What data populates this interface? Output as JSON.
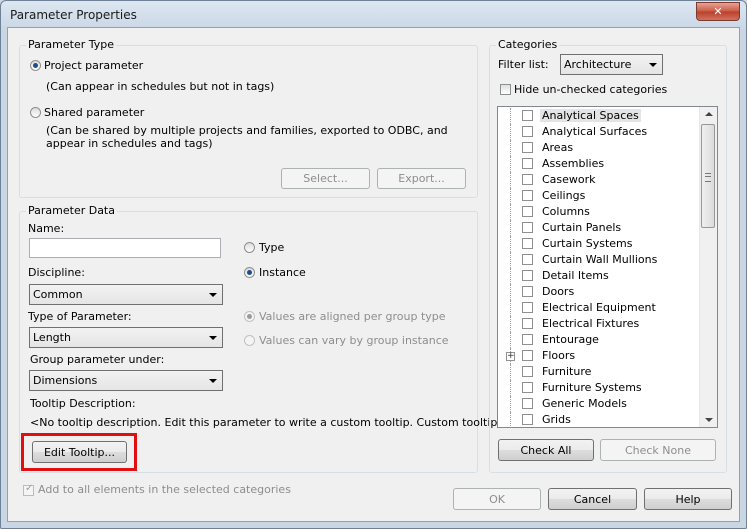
{
  "window": {
    "title": "Parameter Properties",
    "close_glyph": "✕"
  },
  "parameter_type": {
    "label": "Parameter Type",
    "project": {
      "label": "Project parameter",
      "desc": "(Can appear in schedules but not in tags)",
      "selected": true
    },
    "shared": {
      "label": "Shared parameter",
      "desc_line1": "(Can be shared by multiple projects and families, exported to ODBC, and",
      "desc_line2": "appear in schedules and tags)"
    },
    "select_button": "Select...",
    "export_button": "Export..."
  },
  "parameter_data": {
    "label": "Parameter Data",
    "name_label": "Name:",
    "name_value": "",
    "discipline_label": "Discipline:",
    "discipline_value": "Common",
    "type_label": "Type of Parameter:",
    "type_value": "Length",
    "group_label": "Group parameter under:",
    "group_value": "Dimensions",
    "tooltip_label": "Tooltip Description:",
    "tooltip_value": "<No tooltip description. Edit this parameter to write a custom tooltip. Custom tooltips hav...",
    "edit_tooltip_button": "Edit Tooltip...",
    "radio_type": "Type",
    "radio_instance": "Instance",
    "radio_aligned": "Values are aligned per group type",
    "radio_vary": "Values can vary by group instance"
  },
  "add_all": "Add to all elements in the selected categories",
  "categories": {
    "label": "Categories",
    "filter_label": "Filter list:",
    "filter_value": "Architecture",
    "hide_unchecked": "Hide un-checked categories",
    "items": [
      "Analytical Spaces",
      "Analytical Surfaces",
      "Areas",
      "Assemblies",
      "Casework",
      "Ceilings",
      "Columns",
      "Curtain Panels",
      "Curtain Systems",
      "Curtain Wall Mullions",
      "Detail Items",
      "Doors",
      "Electrical Equipment",
      "Electrical Fixtures",
      "Entourage",
      "Floors",
      "Furniture",
      "Furniture Systems",
      "Generic Models",
      "Grids"
    ],
    "check_all": "Check All",
    "check_none": "Check None"
  },
  "buttons": {
    "ok": "OK",
    "cancel": "Cancel",
    "help": "Help"
  },
  "colors": {
    "highlight": "#e01010",
    "title_bg": "#cfd9e5"
  }
}
